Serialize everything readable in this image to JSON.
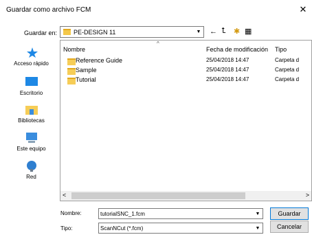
{
  "window": {
    "title": "Guardar como archivo FCM",
    "close_glyph": "✕"
  },
  "location": {
    "label": "Guardar en:",
    "value": "PE-DESIGN 11"
  },
  "toolbar": {
    "back_glyph": "←",
    "up_glyph": "⮤",
    "newfolder_glyph": "✱",
    "view_glyph": "▦"
  },
  "places": [
    {
      "label": "Acceso rápido",
      "icon": "star-icon"
    },
    {
      "label": "Escritorio",
      "icon": "desktop-icon"
    },
    {
      "label": "Bibliotecas",
      "icon": "libraries-icon"
    },
    {
      "label": "Este equipo",
      "icon": "computer-icon"
    },
    {
      "label": "Red",
      "icon": "network-icon"
    }
  ],
  "columns": {
    "name": "Nombre",
    "date": "Fecha de modificación",
    "type": "Tipo"
  },
  "rows": [
    {
      "name": "Reference Guide",
      "date": "25/04/2018 14:47",
      "type": "Carpeta d"
    },
    {
      "name": "Sample",
      "date": "25/04/2018 14:47",
      "type": "Carpeta d"
    },
    {
      "name": "Tutorial",
      "date": "25/04/2018 14:47",
      "type": "Carpeta d"
    }
  ],
  "filename": {
    "label": "Nombre:",
    "value": "tutorialSNC_1.fcm"
  },
  "filetype": {
    "label": "Tipo:",
    "value": "ScanNCut (*.fcm)"
  },
  "buttons": {
    "save": "Guardar",
    "cancel": "Cancelar"
  },
  "colors": {
    "folder": "#f6cd57",
    "accent": "#0078d7"
  }
}
